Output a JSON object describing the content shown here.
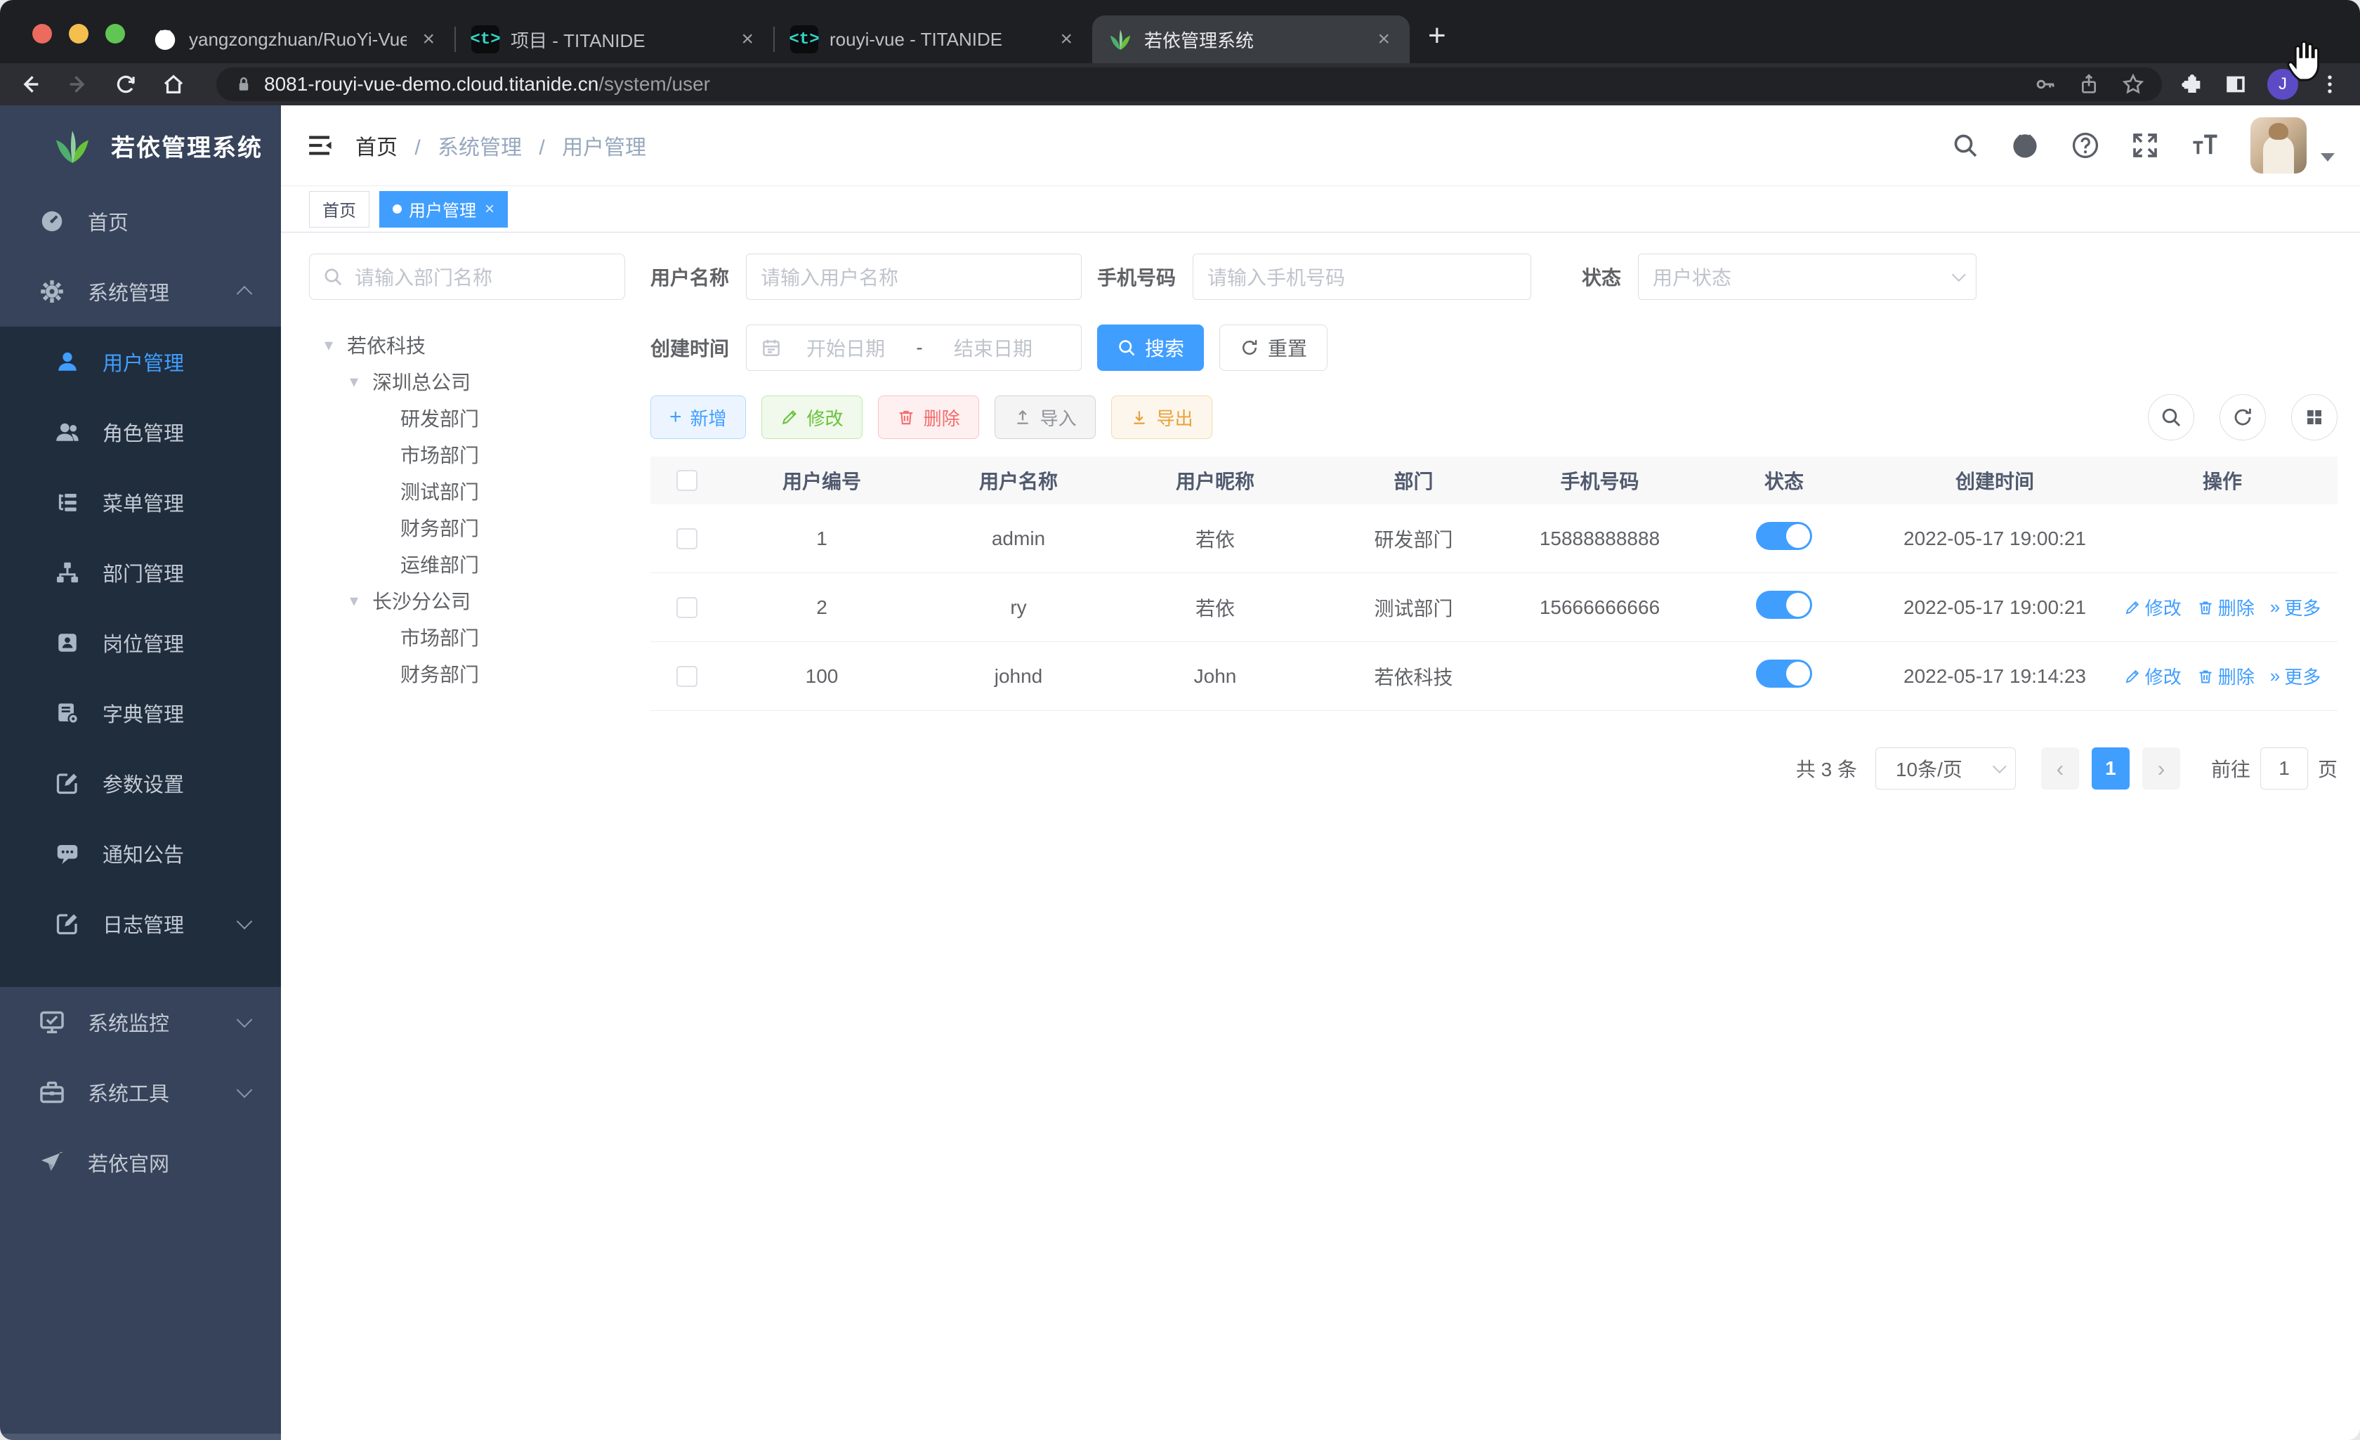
{
  "browser": {
    "tabs": [
      {
        "title": "yangzongzhuan/RuoYi-Vue: (R"
      },
      {
        "title": "项目 - TITANIDE"
      },
      {
        "title": "rouyi-vue - TITANIDE"
      },
      {
        "title": "若依管理系统"
      }
    ],
    "titanide_glyph": "<t>",
    "close_glyph": "×",
    "new_tab_glyph": "+",
    "url_host": "8081-rouyi-vue-demo.cloud.titanide.cn",
    "url_path": "/system/user",
    "avatar_letter": "J"
  },
  "sidebar": {
    "app_title": "若依管理系统",
    "home": "首页",
    "system_mgmt": "系统管理",
    "submenu": [
      "用户管理",
      "角色管理",
      "菜单管理",
      "部门管理",
      "岗位管理",
      "字典管理",
      "参数设置",
      "通知公告",
      "日志管理"
    ],
    "monitor": "系统监控",
    "tools": "系统工具",
    "website": "若依官网"
  },
  "header": {
    "breadcrumb": [
      "首页",
      "系统管理",
      "用户管理"
    ],
    "separator": "/"
  },
  "tags": {
    "home": "首页",
    "active": "用户管理",
    "close": "×"
  },
  "tree": {
    "placeholder": "请输入部门名称",
    "root": "若依科技",
    "b1": "深圳总公司",
    "b1_children": [
      "研发部门",
      "市场部门",
      "测试部门",
      "财务部门",
      "运维部门"
    ],
    "b2": "长沙分公司",
    "b2_children": [
      "市场部门",
      "财务部门"
    ],
    "caret": "▾"
  },
  "filters": {
    "username_label": "用户名称",
    "username_placeholder": "请输入用户名称",
    "phone_label": "手机号码",
    "phone_placeholder": "请输入手机号码",
    "status_label": "状态",
    "status_placeholder": "用户状态",
    "date_label": "创建时间",
    "date_start": "开始日期",
    "date_dash": "-",
    "date_end": "结束日期",
    "search": "搜索",
    "reset": "重置"
  },
  "toolbar": {
    "add": "新增",
    "edit": "修改",
    "del": "删除",
    "imp": "导入",
    "exp": "导出"
  },
  "table": {
    "columns": [
      "用户编号",
      "用户名称",
      "用户昵称",
      "部门",
      "手机号码",
      "状态",
      "创建时间",
      "操作"
    ],
    "rows": [
      {
        "id": "1",
        "name": "admin",
        "nick": "若依",
        "dept": "研发部门",
        "phone": "15888888888",
        "time": "2022-05-17 19:00:21"
      },
      {
        "id": "2",
        "name": "ry",
        "nick": "若依",
        "dept": "测试部门",
        "phone": "15666666666",
        "time": "2022-05-17 19:00:21"
      },
      {
        "id": "100",
        "name": "johnd",
        "nick": "John",
        "dept": "若依科技",
        "phone": "",
        "time": "2022-05-17 19:14:23"
      }
    ],
    "actions": {
      "edit": "修改",
      "del": "删除",
      "more": "更多",
      "more_glyph": "»"
    }
  },
  "pagination": {
    "total": "共 3 条",
    "page_size": "10条/页",
    "prev_glyph": "‹",
    "next_glyph": "›",
    "page": "1",
    "goto": "前往",
    "goto_value": "1",
    "unit": "页"
  },
  "colors": {
    "accent": "#409eff",
    "sidebar_bg": "#36435a",
    "submenu_bg": "#1f2d3d",
    "success": "#67c23a",
    "danger": "#f56c6c",
    "warning": "#e6a23c",
    "info": "#909399"
  }
}
